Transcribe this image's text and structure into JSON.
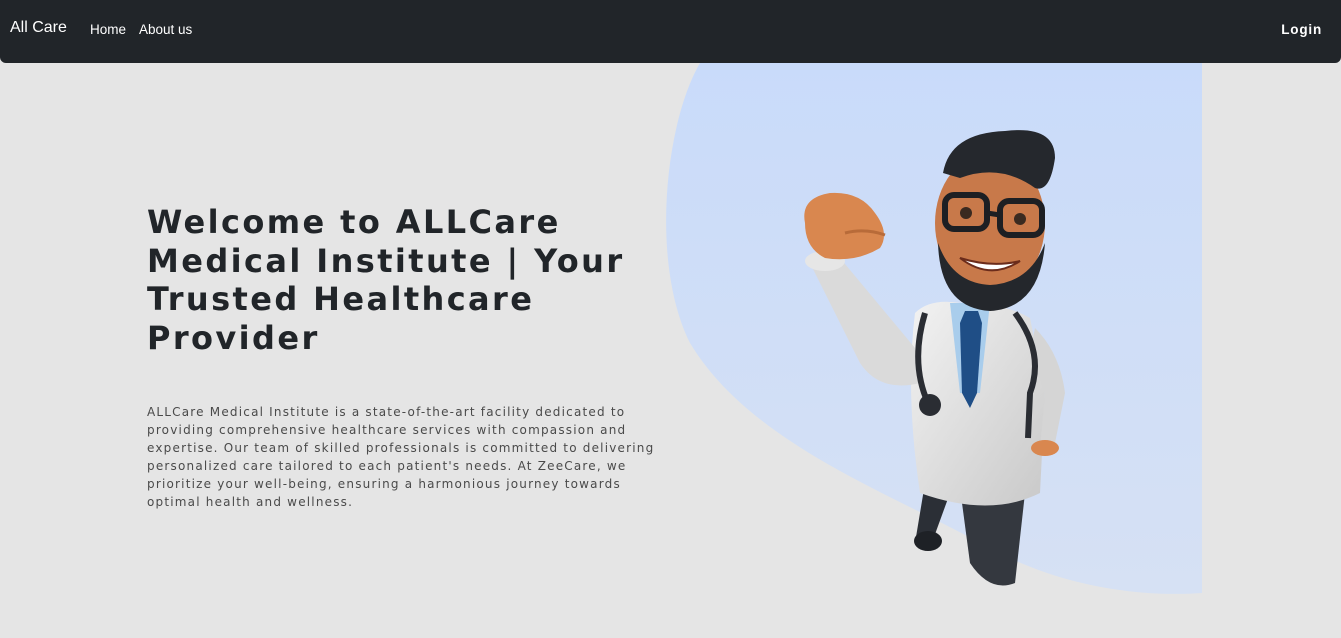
{
  "navbar": {
    "brand": "All Care",
    "links": [
      "Home",
      "About us"
    ],
    "login_label": "Login"
  },
  "hero": {
    "title": "Welcome to ALLCare Medical Institute | Your Trusted Healthcare Provider",
    "description": "ALLCare Medical Institute is a state-of-the-art facility dedicated to providing comprehensive healthcare services with compassion and expertise. Our team of skilled professionals is committed to delivering personalized care tailored to each patient's needs. At ZeeCare, we prioritize your well-being, ensuring a harmonious journey towards optimal health and wellness.",
    "illustration_icon": "doctor-superhero-illustration"
  },
  "colors": {
    "navbar_bg": "#212529",
    "page_bg": "#e5e5e5",
    "blob": "#cddcf6",
    "title_text": "#212529"
  }
}
